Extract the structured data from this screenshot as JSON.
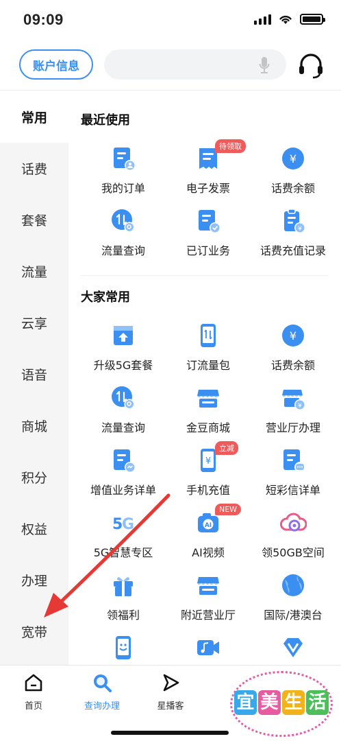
{
  "status_bar": {
    "time": "09:09"
  },
  "header": {
    "account_label": "账户信息",
    "search_placeholder": ""
  },
  "sidebar": {
    "items": [
      {
        "label": "常用"
      },
      {
        "label": "话费"
      },
      {
        "label": "套餐"
      },
      {
        "label": "流量"
      },
      {
        "label": "云享"
      },
      {
        "label": "语音"
      },
      {
        "label": "商城"
      },
      {
        "label": "积分"
      },
      {
        "label": "权益"
      },
      {
        "label": "办理"
      },
      {
        "label": "宽带"
      }
    ]
  },
  "recent": {
    "title": "最近使用",
    "items": [
      {
        "label": "我的订单",
        "icon": "order-doc-icon"
      },
      {
        "label": "电子发票",
        "icon": "invoice-icon",
        "tag": "待领取"
      },
      {
        "label": "话费余额",
        "icon": "yen-circle-icon"
      },
      {
        "label": "流量查询",
        "icon": "data-query-icon"
      },
      {
        "label": "已订业务",
        "icon": "subscribed-doc-icon"
      },
      {
        "label": "话费充值记录",
        "icon": "recharge-record-icon"
      }
    ]
  },
  "popular": {
    "title": "大家常用",
    "items": [
      {
        "label": "升级5G套餐",
        "icon": "upload-box-icon"
      },
      {
        "label": "订流量包",
        "icon": "phone-data-icon"
      },
      {
        "label": "话费余额",
        "icon": "yen-circle-icon"
      },
      {
        "label": "流量查询",
        "icon": "data-query-icon"
      },
      {
        "label": "金豆商城",
        "icon": "shop-icon"
      },
      {
        "label": "营业厅办理",
        "icon": "store-yen-icon"
      },
      {
        "label": "增值业务详单",
        "icon": "doc-chat-icon"
      },
      {
        "label": "手机充值",
        "icon": "phone-yen-icon",
        "tag": "立减"
      },
      {
        "label": "短彩信详单",
        "icon": "doc-message-icon"
      },
      {
        "label": "5G智慧专区",
        "icon": "5g-icon"
      },
      {
        "label": "AI视频",
        "icon": "camera-icon",
        "tag": "NEW"
      },
      {
        "label": "领50GB空间",
        "icon": "cloud-icon"
      },
      {
        "label": "领福利",
        "icon": "gift-icon"
      },
      {
        "label": "附近营业厅",
        "icon": "store-icon"
      },
      {
        "label": "国际/港澳台",
        "icon": "globe-icon"
      },
      {
        "label": "",
        "icon": "face-phone-icon"
      },
      {
        "label": "",
        "icon": "video-music-icon"
      },
      {
        "label": "",
        "icon": "v-badge-icon"
      }
    ]
  },
  "tabbar": {
    "tabs": [
      {
        "label": "首页",
        "icon": "home-icon"
      },
      {
        "label": "查询办理",
        "icon": "query-icon"
      },
      {
        "label": "星播客",
        "icon": "play-icon"
      }
    ]
  },
  "watermark": {
    "text": [
      "宜",
      "美",
      "生",
      "活"
    ]
  },
  "colors": {
    "accent": "#3a8ff0",
    "tag_red": "#ef5a5a"
  }
}
